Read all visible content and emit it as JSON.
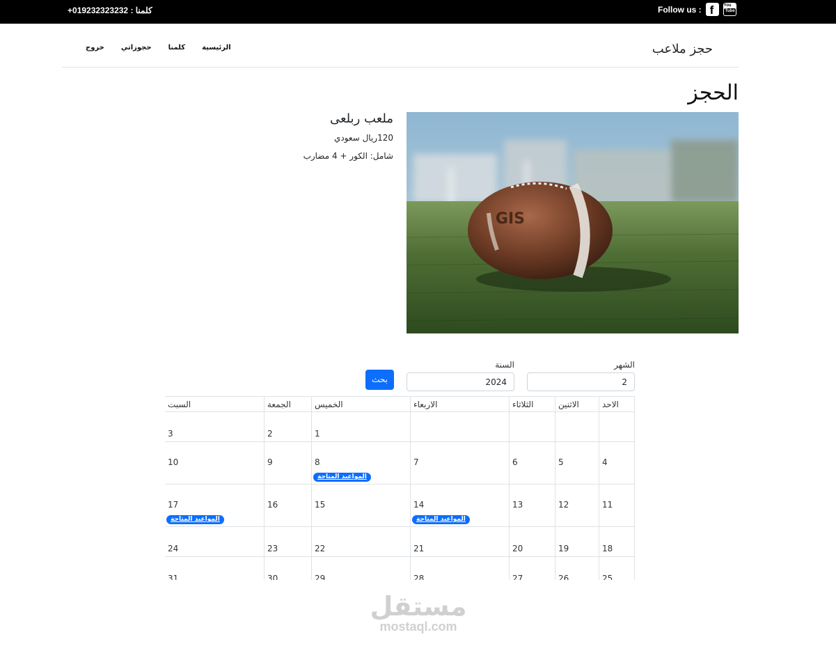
{
  "topbar": {
    "follow_label": "Follow us :",
    "facebook_icon": "facebook-icon",
    "youtube_icon": "youtube-icon",
    "youtube_text_top": "You",
    "youtube_text_bottom": "Tube",
    "contact": "كلمنا : 019232323232+"
  },
  "navbar": {
    "brand": "حجز ملاعب",
    "links": [
      "الرئيسية",
      "كلمنا",
      "حجوزاتي",
      "خروج"
    ]
  },
  "page": {
    "title": "الحجز"
  },
  "field": {
    "name": "ملعب ربلعى",
    "price": "120ريال سعودي",
    "includes": "شامل: الكور + 4 مضارب",
    "image": "american-football-on-grass-photo"
  },
  "search": {
    "month_label": "الشهر",
    "month_value": "2",
    "year_label": "السنة",
    "year_value": "2024",
    "button_label": "بحث"
  },
  "calendar": {
    "headers": [
      "الاحد",
      "الاثنين",
      "الثلاثاء",
      "الاربعاء",
      "الخميس",
      "الجمعة",
      "السبت"
    ],
    "badge_label": "المواعيد المتاحة",
    "weeks": [
      [
        "",
        "",
        "",
        "",
        "1",
        "2",
        "3"
      ],
      [
        "4",
        "5",
        "6",
        "7",
        "8",
        "9",
        "10"
      ],
      [
        "11",
        "12",
        "13",
        "14",
        "15",
        "16",
        "17"
      ],
      [
        "18",
        "19",
        "20",
        "21",
        "22",
        "23",
        "24"
      ],
      [
        "25",
        "26",
        "27",
        "28",
        "29",
        "30",
        "31"
      ]
    ]
  },
  "watermark": {
    "arabic": "مستقل",
    "latin": "mostaql.com"
  },
  "colors": {
    "accent": "#0d6efd",
    "topbar": "#000000"
  }
}
